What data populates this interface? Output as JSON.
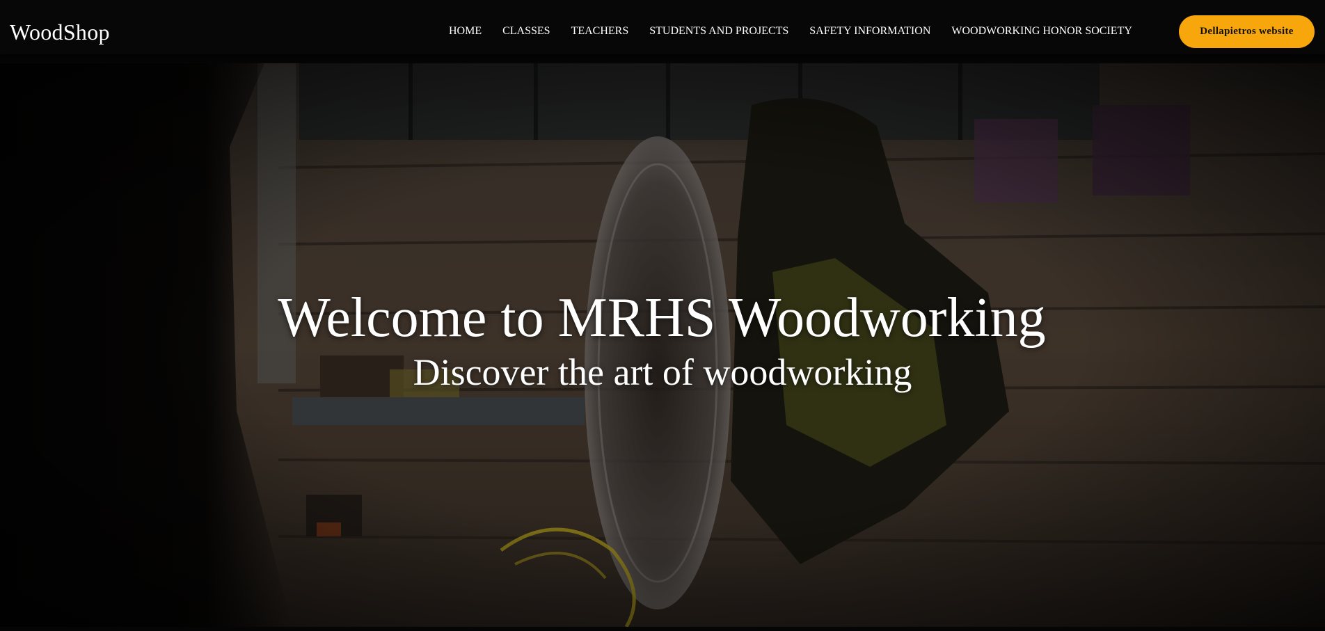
{
  "navbar": {
    "logo": "WoodShop",
    "links": [
      {
        "label": "HOME"
      },
      {
        "label": "CLASSES"
      },
      {
        "label": "TEACHERS"
      },
      {
        "label": "STUDENTS AND PROJECTS"
      },
      {
        "label": "SAFETY INFORMATION"
      },
      {
        "label": "WOODWORKING HONOR SOCIETY"
      }
    ],
    "cta_label": "Dellapietros website"
  },
  "hero": {
    "title": "Welcome to MRHS Woodworking",
    "subtitle": "Discover the art of woodworking",
    "background": "woodshop-miter-saw-video"
  },
  "colors": {
    "nav_bg": "#070707",
    "cta_bg": "#f7a70c",
    "text": "#ffffff"
  }
}
